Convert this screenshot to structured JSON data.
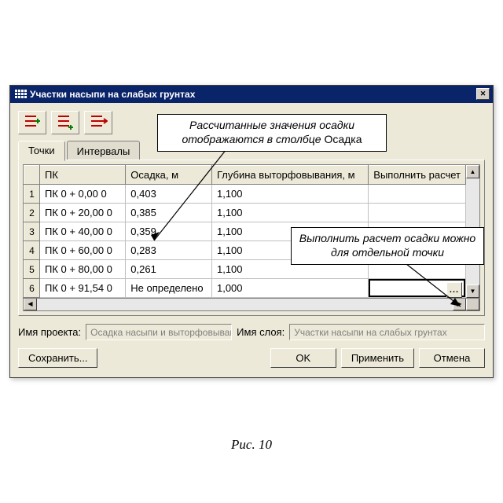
{
  "window": {
    "title": "Участки насыпи на слабых грунтах"
  },
  "toolbar_icons": [
    "add-sibling-icon",
    "add-child-icon",
    "remove-icon"
  ],
  "callouts": {
    "c1a": "Рассчитанные значения осадки",
    "c1b": "отображаются в столбце",
    "c1c": "Осадка",
    "c2a": "Выполнить расчет осадки можно",
    "c2b": "для отдельной точки"
  },
  "tabs": {
    "t1": "Точки",
    "t2": "Интервалы"
  },
  "columns": {
    "pk": "ПК",
    "osadka": "Осадка, м",
    "glub": "Глубина выторфовывания, м",
    "vr": "Выполнить расчет"
  },
  "rows": [
    {
      "n": "1",
      "pk": "ПК    0 + 0,00  0",
      "os": "0,403",
      "gl": "1,100"
    },
    {
      "n": "2",
      "pk": "ПК    0 + 20,00  0",
      "os": "0,385",
      "gl": "1,100"
    },
    {
      "n": "3",
      "pk": "ПК    0 + 40,00  0",
      "os": "0,359",
      "gl": "1,100"
    },
    {
      "n": "4",
      "pk": "ПК    0 + 60,00  0",
      "os": "0,283",
      "gl": "1,100"
    },
    {
      "n": "5",
      "pk": "ПК    0 + 80,00  0",
      "os": "0,261",
      "gl": "1,100"
    },
    {
      "n": "6",
      "pk": "ПК    0 + 91,54  0",
      "os": "Не определено",
      "gl": "1,000"
    }
  ],
  "cellbtn": "...",
  "labels": {
    "proj": "Имя проекта:",
    "layer": "Имя слоя:"
  },
  "fields": {
    "proj": "Осадка насыпи и выторфовывание",
    "layer": "Участки насыпи на слабых грунтах"
  },
  "buttons": {
    "save": "Сохранить...",
    "ok": "OK",
    "apply": "Применить",
    "cancel": "Отмена"
  },
  "figure": "Рис. 10"
}
